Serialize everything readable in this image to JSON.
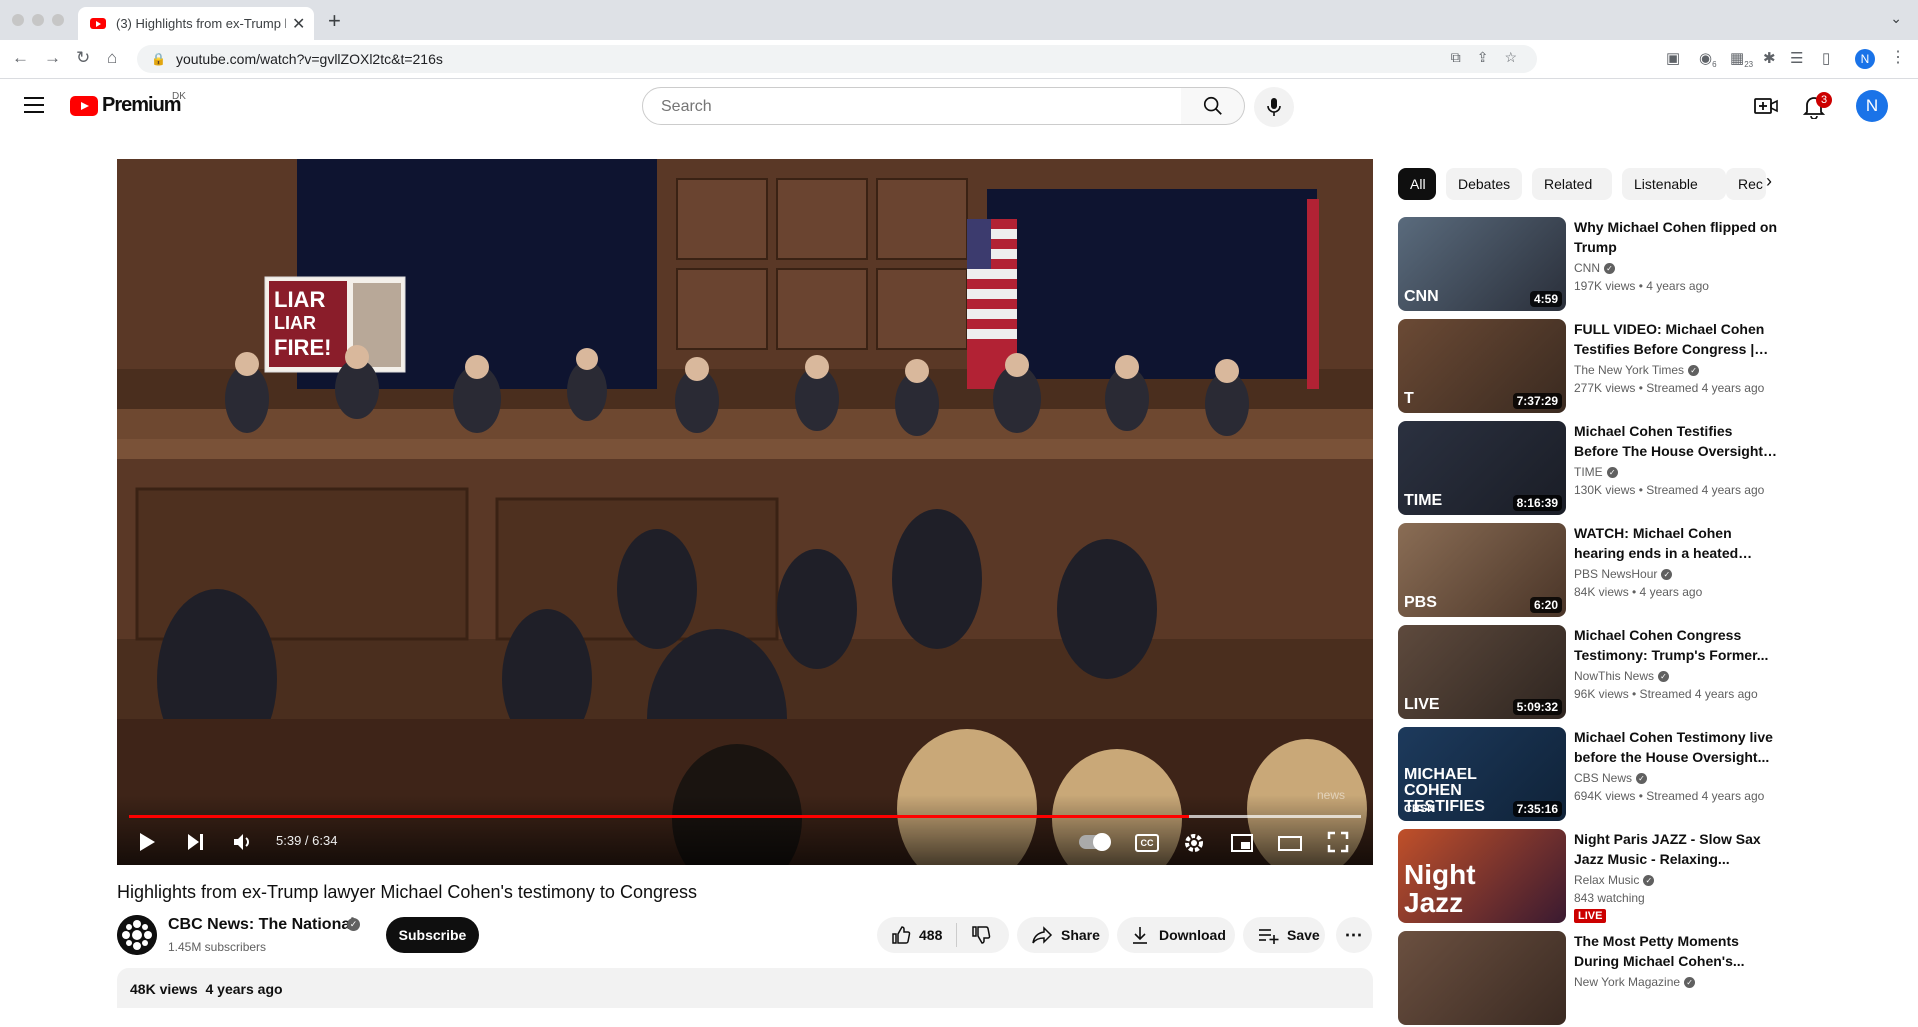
{
  "browser": {
    "tab_title": "(3) Highlights from ex-Trump l",
    "url": "youtube.com/watch?v=gvllZOXl2tc&t=216s",
    "ext_badges": [
      "6",
      "23"
    ]
  },
  "masthead": {
    "logo_text": "Premium",
    "country": "DK",
    "search_placeholder": "Search",
    "notifications_count": "3",
    "avatar_letter": "N"
  },
  "player": {
    "time": "5:39 / 6:34",
    "progress": 0.86,
    "sign_text": [
      "LIAR",
      "LIAR",
      "FIRE!"
    ],
    "cc_label": "CC",
    "watermark": "news"
  },
  "video": {
    "title": "Highlights from ex-Trump lawyer Michael Cohen's testimony to Congress",
    "channel": "CBC News: The National",
    "subscribers": "1.45M subscribers",
    "subscribe_label": "Subscribe",
    "likes": "488",
    "share_label": "Share",
    "download_label": "Download",
    "save_label": "Save",
    "views": "48K views",
    "age": "4 years ago"
  },
  "chips": [
    "All",
    "Debates",
    "Related",
    "Listenable",
    "Rec"
  ],
  "recommendations": [
    {
      "title": "Why Michael Cohen flipped on Trump",
      "channel": "CNN",
      "meta": "197K views • 4 years ago",
      "duration": "4:59",
      "thumb_text": "CNN",
      "colors": [
        "#5a6b7d",
        "#2a2f3a"
      ]
    },
    {
      "title": "FULL VIDEO: Michael Cohen Testifies Before Congress | NY...",
      "channel": "The New York Times",
      "meta": "277K views • Streamed 4 years ago",
      "duration": "7:37:29",
      "thumb_text": "T",
      "colors": [
        "#6b4a35",
        "#3a2a20"
      ]
    },
    {
      "title": "Michael Cohen Testifies Before The House Oversight And...",
      "channel": "TIME",
      "meta": "130K views • Streamed 4 years ago",
      "duration": "8:16:39",
      "thumb_text": "TIME",
      "colors": [
        "#2b3140",
        "#1a1d26"
      ]
    },
    {
      "title": "WATCH: Michael Cohen hearing ends in a heated exchange ov...",
      "channel": "PBS NewsHour",
      "meta": "84K views • 4 years ago",
      "duration": "6:20",
      "thumb_text": "PBS",
      "colors": [
        "#8a6d55",
        "#4a3528"
      ]
    },
    {
      "title": "Michael Cohen Congress Testimony: Trump's Former...",
      "channel": "NowThis News",
      "meta": "96K views • Streamed 4 years ago",
      "duration": "5:09:32",
      "thumb_text": "LIVE",
      "colors": [
        "#5e4a3d",
        "#2e2520"
      ]
    },
    {
      "title": "Michael Cohen Testimony live before the House Oversight...",
      "channel": "CBS News",
      "meta": "694K views • Streamed 4 years ago",
      "duration": "7:35:16",
      "thumb_text": "MICHAEL COHEN TESTIFIES",
      "thumb_sub": "CBSN",
      "colors": [
        "#1d3a5c",
        "#0f2238"
      ]
    },
    {
      "title": "Night Paris JAZZ - Slow Sax Jazz Music - Relaxing...",
      "channel": "Relax Music",
      "meta": "843 watching",
      "duration": "",
      "thumb_text": "Night Jazz",
      "live": "LIVE",
      "colors": [
        "#c0502a",
        "#3a1a30"
      ]
    },
    {
      "title": "The Most Petty Moments During Michael Cohen's...",
      "channel": "New York Magazine",
      "meta": "",
      "duration": "",
      "thumb_text": "",
      "colors": [
        "#6b5040",
        "#3a2a22"
      ]
    }
  ]
}
